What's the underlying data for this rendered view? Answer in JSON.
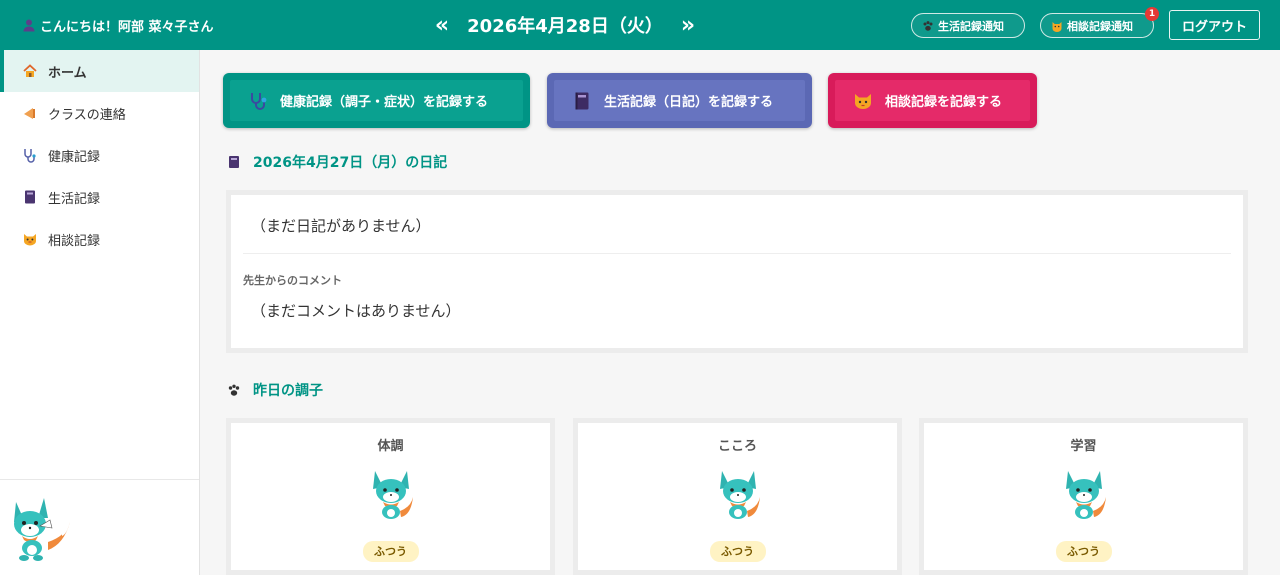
{
  "header": {
    "greeting": "こんにちは！阿部 菜々子さん",
    "prev_label": "«",
    "date": "2026年4月28日（火）",
    "next_label": "»",
    "life_notify_label": "生活記録通知",
    "consult_notify_label": "相談記録通知",
    "consult_notify_count": "1",
    "logout_label": "ログアウト"
  },
  "sidebar": {
    "items": [
      {
        "label": "ホーム",
        "icon": "house-icon",
        "active": true
      },
      {
        "label": "クラスの連絡",
        "icon": "megaphone-icon",
        "active": false
      },
      {
        "label": "健康記録",
        "icon": "stethoscope-icon",
        "active": false
      },
      {
        "label": "生活記録",
        "icon": "notebook-icon",
        "active": false
      },
      {
        "label": "相談記録",
        "icon": "cat-face-icon",
        "active": false
      }
    ]
  },
  "actions": {
    "health_label": "健康記録（調子・症状）を記録する",
    "life_label": "生活記録（日記）を記録する",
    "consult_label": "相談記録を記録する"
  },
  "diary": {
    "title": "2026年4月27日（月）の日記",
    "empty_text": "（まだ日記がありません）",
    "comment_label": "先生からのコメント",
    "comment_text": "（まだコメントはありません）"
  },
  "condition": {
    "title": "昨日の調子",
    "cards": [
      {
        "name": "体調",
        "level": "ふつう"
      },
      {
        "name": "こころ",
        "level": "ふつう"
      },
      {
        "name": "学習",
        "level": "ふつう"
      }
    ]
  },
  "colors": {
    "primary": "#009485",
    "life": "#5b68b4",
    "consult": "#d81b5a",
    "badge": "#e53935"
  }
}
